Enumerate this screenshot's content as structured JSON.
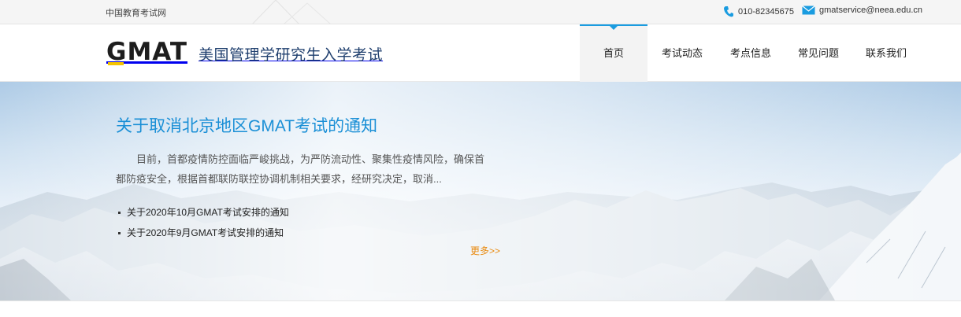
{
  "topbar": {
    "site_link": "中国教育考试网",
    "phone": "010-82345675",
    "email": "gmatservice@neea.edu.cn",
    "phone_icon": "phone-icon",
    "mail_icon": "mail-icon"
  },
  "header": {
    "logo_mark": "GMAT",
    "logo_text": "美国管理学研究生入学考试"
  },
  "nav": {
    "items": [
      {
        "label": "首页",
        "active": true
      },
      {
        "label": "考试动态"
      },
      {
        "label": "考点信息"
      },
      {
        "label": "常见问题"
      },
      {
        "label": "联系我们"
      }
    ]
  },
  "banner": {
    "title": "关于取消北京地区GMAT考试的通知",
    "summary": "目前，首都疫情防控面临严峻挑战，为严防流动性、聚集性疫情风险，确保首都防疫安全，根据首都联防联控协调机制相关要求，经研究决定，取消...",
    "news": [
      "关于2020年10月GMAT考试安排的通知",
      "关于2020年9月GMAT考试安排的通知"
    ],
    "more": "更多>>"
  },
  "colors": {
    "accent_blue": "#1a9ce0",
    "title_blue": "#1a8fd6",
    "logo_yellow": "#f5c400",
    "more_orange": "#e98a10"
  }
}
